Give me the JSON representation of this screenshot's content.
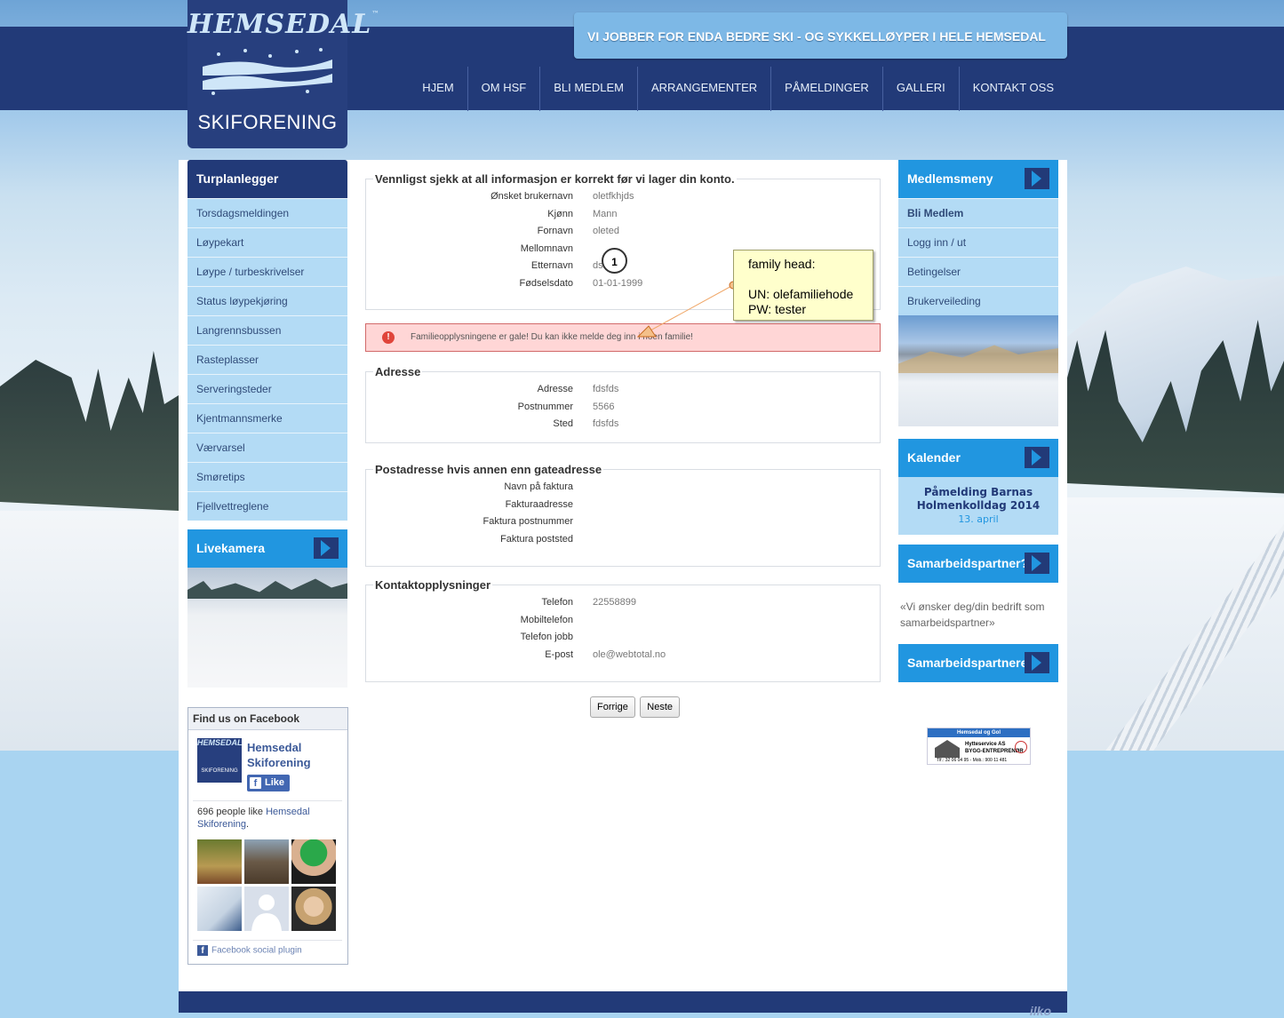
{
  "header": {
    "logo_top": "HEMSEDAL",
    "logo_tm": "™",
    "logo_bottom": "SKIFORENING",
    "slogan": "VI JOBBER FOR ENDA BEDRE SKI - OG SYKKELLØYPER I HELE HEMSEDAL",
    "nav": [
      "HJEM",
      "OM HSF",
      "BLI MEDLEM",
      "ARRANGEMENTER",
      "PÅMELDINGER",
      "GALLERI",
      "KONTAKT OSS"
    ]
  },
  "left": {
    "menu_title": "Turplanlegger",
    "menu": [
      "Torsdagsmeldingen",
      "Løypekart",
      "Løype / turbeskrivelser",
      "Status løypekjøring",
      "Langrennsbussen",
      "Rasteplasser",
      "Serveringsteder",
      "Kjentmannsmerke",
      "Værvarsel",
      "Smøretips",
      "Fjellvettreglene"
    ],
    "livecam_title": "Livekamera",
    "facebook": {
      "title": "Find us on Facebook",
      "page_name": "Hemsedal Skiforening",
      "logo_text": "HEMSEDAL",
      "logo_sub": "SKIFORENING",
      "like_label": "Like",
      "count_prefix": "696 people like ",
      "count_link": "Hemsedal Skiforening",
      "count_suffix": ".",
      "plugin_label": "Facebook social plugin"
    }
  },
  "main": {
    "confirm": {
      "legend": "Vennligst sjekk at all informasjon er korrekt før vi lager din konto.",
      "rows": [
        {
          "label": "Ønsket brukernavn",
          "value": "oletfkhjds"
        },
        {
          "label": "Kjønn",
          "value": "Mann"
        },
        {
          "label": "Fornavn",
          "value": "oleted"
        },
        {
          "label": "Mellomnavn",
          "value": ""
        },
        {
          "label": "Etternavn",
          "value": "dsa"
        },
        {
          "label": "Fødselsdato",
          "value": "01-01-1999"
        }
      ]
    },
    "error": {
      "icon": "!",
      "text": "Familieopplysningene er gale! Du kan ikke melde deg inn i noen familie!"
    },
    "address": {
      "legend": "Adresse",
      "rows": [
        {
          "label": "Adresse",
          "value": "fdsfds"
        },
        {
          "label": "Postnummer",
          "value": "5566"
        },
        {
          "label": "Sted",
          "value": "fdsfds"
        }
      ]
    },
    "postal": {
      "legend": "Postadresse hvis annen enn gateadresse",
      "rows": [
        {
          "label": "Navn på faktura",
          "value": ""
        },
        {
          "label": "Fakturaadresse",
          "value": ""
        },
        {
          "label": "Faktura postnummer",
          "value": ""
        },
        {
          "label": "Faktura poststed",
          "value": ""
        }
      ]
    },
    "contact": {
      "legend": "Kontaktopplysninger",
      "rows": [
        {
          "label": "Telefon",
          "value": "22558899"
        },
        {
          "label": "Mobiltelefon",
          "value": ""
        },
        {
          "label": "Telefon jobb",
          "value": ""
        },
        {
          "label": "E-post",
          "value": "ole@webtotal.no"
        }
      ]
    },
    "buttons": {
      "prev": "Forrige",
      "next": "Neste"
    }
  },
  "annotation": {
    "marker": "1",
    "line1": "family head:",
    "line2": "UN: olefamiliehode",
    "line3": "PW: tester"
  },
  "right": {
    "member_title": "Medlemsmeny",
    "member_menu": [
      "Bli Medlem",
      "Logg inn / ut",
      "Betingelser",
      "Brukerveileding"
    ],
    "calendar_title": "Kalender",
    "calendar_event": "Påmelding Barnas Holmenkolldag 2014",
    "calendar_date": "13. april",
    "partner_q_title": "Samarbeidspartner?",
    "partner_text": "«Vi ønsker deg/din bedrift som samarbeidspartner»",
    "partners_title": "Samarbeidspartnere",
    "ad": {
      "top": "Hemsedal og Gol",
      "name": "Hytteservice AS",
      "sub": "BYGG-ENTREPRENØR",
      "phone": "Tlf.: 32 06 04 95  -  Mob.: 900 11 481"
    }
  },
  "footer": {
    "mark": "ilko"
  },
  "colors": {
    "navy": "#223a78",
    "accent_blue": "#2196e0",
    "menu_bg": "#b3dbf5",
    "error_bg": "#ffd6d6",
    "note_bg": "#ffffcc"
  }
}
